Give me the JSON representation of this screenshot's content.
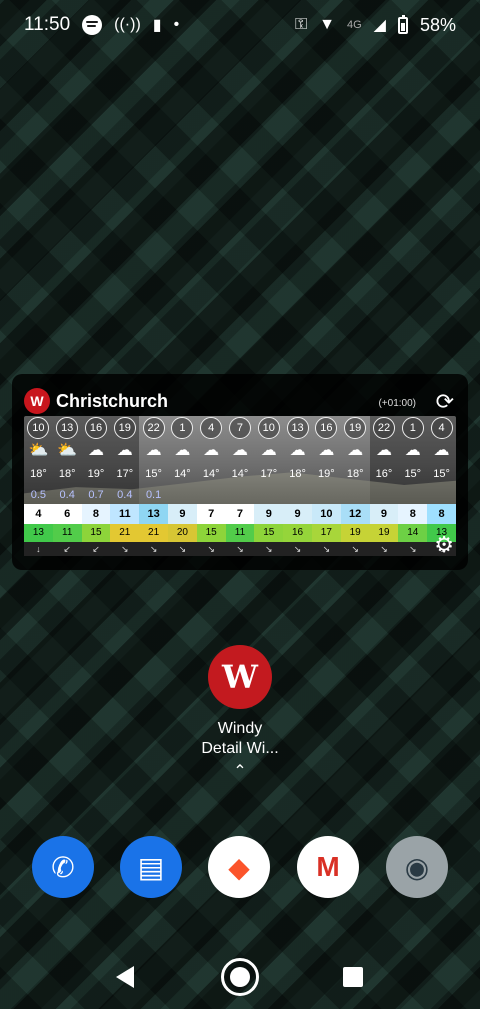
{
  "status_bar": {
    "time": "11:50",
    "network": "4G",
    "battery": "58%",
    "battery_level": 0.58,
    "dot": "•"
  },
  "widget": {
    "city": "Christchurch",
    "timezone": "(+01:00)",
    "gusts": [
      "10",
      "13",
      "16",
      "19",
      "22",
      "1",
      "4",
      "7",
      "10",
      "13",
      "16",
      "19",
      "22",
      "1",
      "4"
    ],
    "icons": [
      "sun-cloud-rain",
      "sun-cloud-rain",
      "cloud-rain",
      "cloud-rain",
      "moon-cloud",
      "cloud",
      "moon-cloud",
      "cloud",
      "cloud",
      "cloud",
      "cloud",
      "cloud",
      "moon-cloud",
      "moon-cloud",
      "moon-cloud"
    ],
    "temps": [
      "18°",
      "18°",
      "19°",
      "17°",
      "15°",
      "14°",
      "14°",
      "14°",
      "17°",
      "18°",
      "19°",
      "18°",
      "16°",
      "15°",
      "15°"
    ],
    "rain": [
      "0.5",
      "0.4",
      "0.7",
      "0.4",
      "0.1",
      "",
      "",
      "",
      "",
      "",
      "",
      "",
      "",
      "",
      ""
    ],
    "wind": [
      "4",
      "6",
      "8",
      "11",
      "13",
      "9",
      "7",
      "7",
      "9",
      "9",
      "10",
      "12",
      "9",
      "8",
      "8"
    ],
    "wind_gusts": [
      "13",
      "11",
      "15",
      "21",
      "21",
      "20",
      "15",
      "11",
      "15",
      "16",
      "17",
      "19",
      "19",
      "14",
      "13"
    ],
    "directions": [
      "↓",
      "↙",
      "↙",
      "↘",
      "↘",
      "↘",
      "↘",
      "↘",
      "↘",
      "↘",
      "↘",
      "↘",
      "↘",
      "↘",
      "↘"
    ],
    "wind_colors": [
      "#ffffff",
      "#ffffff",
      "#e6f4ff",
      "#bfe6ff",
      "#8fd6f3",
      "#d8eef8",
      "#ffffff",
      "#ffffff",
      "#d8eef8",
      "#d8eef8",
      "#c9e9f9",
      "#a9def7",
      "#d8eef8",
      "#e6f4ff",
      "#9fe0ff"
    ],
    "gust_colors": [
      "#41c94a",
      "#52cc4a",
      "#8dd43a",
      "#e3c832",
      "#e3c832",
      "#d7c634",
      "#8dd43a",
      "#52cc4a",
      "#8dd43a",
      "#95d53a",
      "#a8d63a",
      "#c6d336",
      "#c6d336",
      "#6dd045",
      "#41c94a"
    ]
  },
  "app": {
    "label_line1": "Windy",
    "label_line2": "Detail Wi..."
  }
}
